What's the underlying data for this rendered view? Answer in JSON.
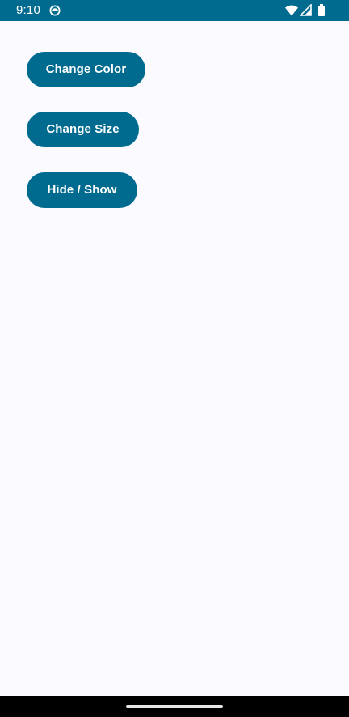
{
  "status_bar": {
    "time": "9:10",
    "background_color": "#006B8F",
    "icons": [
      "app-notification-icon",
      "wifi-icon",
      "cellular-signal-icon",
      "battery-icon"
    ]
  },
  "main": {
    "background_color": "#FBFBFF",
    "buttons": [
      {
        "label": "Change Color"
      },
      {
        "label": "Change Size"
      },
      {
        "label": "Hide / Show"
      }
    ],
    "button_color": "#006B8F"
  },
  "nav_bar": {
    "background_color": "#000000",
    "handle_icon": "home-gesture-handle"
  }
}
